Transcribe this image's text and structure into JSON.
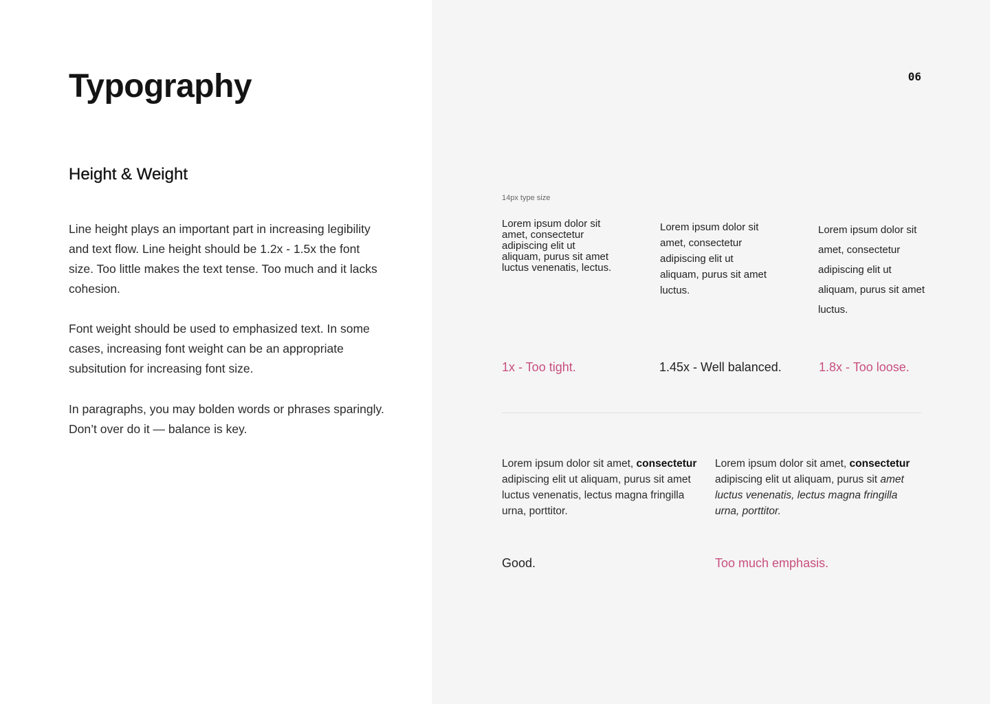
{
  "header": {
    "title": "Typography",
    "page_number": "06"
  },
  "section": {
    "heading": "Height & Weight",
    "paragraphs": [
      "Line height plays an important part in increasing legibility and text flow. Line height should be 1.2x - 1.5x the font size. Too little makes the text tense. Too much and it lacks cohesion.",
      "Font weight should be used to emphasized text. In some cases, increasing font weight can be an appropriate subsitution for increasing font size.",
      "In paragraphs, you may bolden words or phrases sparingly. Don’t over do it — balance is key."
    ]
  },
  "line_height_demo": {
    "caption": "14px type size",
    "sample_text": "Lorem ipsum dolor sit amet, consectetur adipiscing elit ut aliquam, purus sit amet luctus venenatis, lectus.",
    "sample_text_short": "Lorem ipsum dolor sit amet, consectetur adipiscing elit ut aliquam, purus sit amet luctus.",
    "examples": [
      {
        "label": "1x - Too tight.",
        "status": "bad"
      },
      {
        "label": "1.45x - Well balanced.",
        "status": "good"
      },
      {
        "label": "1.8x - Too loose.",
        "status": "bad"
      }
    ]
  },
  "emphasis_demo": {
    "text_before": "Lorem ipsum dolor sit amet, ",
    "bold_text": "consectetur",
    "good_rest": " adipiscing elit ut aliquam, purus sit amet luctus venenatis, lectus magna fringilla urna, porttitor.",
    "bad_middle": " adipiscing elit ut aliquam, purus sit ",
    "italic_text": "amet luctus venenatis, lectus magna fringilla urna, porttitor.",
    "examples": [
      {
        "label": "Good.",
        "status": "good"
      },
      {
        "label": "Too much emphasis.",
        "status": "bad"
      }
    ]
  },
  "colors": {
    "bad": "#c84f7f",
    "text": "#222222",
    "panel_background": "#f5f5f5"
  }
}
